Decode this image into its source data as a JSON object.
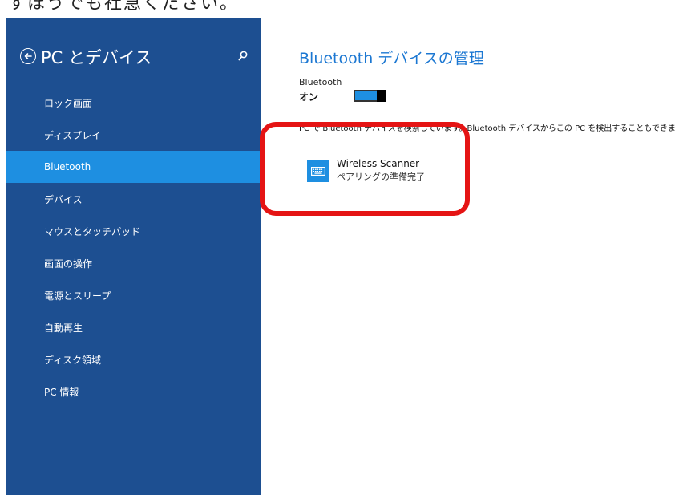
{
  "caption": "すほうでも社急ください。",
  "sidebar": {
    "title": "PC とデバイス",
    "items": [
      {
        "label": "ロック画面"
      },
      {
        "label": "ディスプレイ"
      },
      {
        "label": "Bluetooth"
      },
      {
        "label": "デバイス"
      },
      {
        "label": "マウスとタッチパッド"
      },
      {
        "label": "画面の操作"
      },
      {
        "label": "電源とスリープ"
      },
      {
        "label": "自動再生"
      },
      {
        "label": "ディスク領域"
      },
      {
        "label": "PC 情報"
      }
    ],
    "selected_index": 2
  },
  "main": {
    "title": "Bluetooth デバイスの管理",
    "bluetooth_label": "Bluetooth",
    "bluetooth_state": "オン",
    "info_text": "PC で Bluetooth デバイスを検索しています。Bluetooth デバイスからこの PC を検出することもできます。",
    "device": {
      "name": "Wireless Scanner",
      "status": "ペアリングの準備完了",
      "icon": "keyboard-icon"
    }
  },
  "colors": {
    "sidebar_bg": "#1d4f91",
    "selected_bg": "#1e8fe1",
    "accent": "#1b77d2",
    "highlight": "#e51414"
  }
}
